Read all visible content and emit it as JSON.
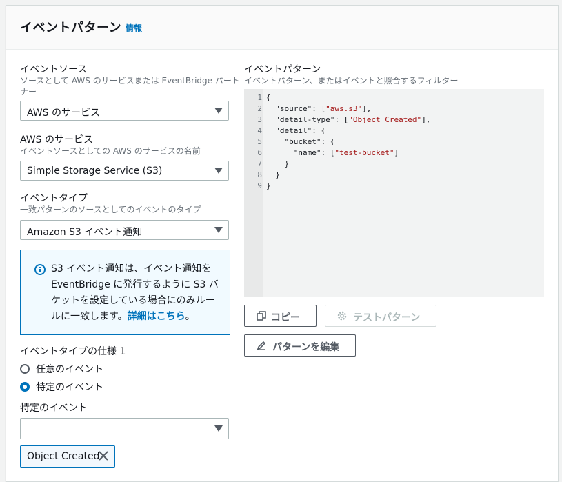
{
  "header": {
    "title": "イベントパターン",
    "info": "情報"
  },
  "event_source": {
    "label": "イベントソース",
    "desc1": "ソースとして AWS のサービスまたは EventBridge パート",
    "desc2": "ナー",
    "value": "AWS のサービス"
  },
  "aws_service": {
    "label": "AWS のサービス",
    "desc": "イベントソースとしての AWS のサービスの名前",
    "value": "Simple Storage Service (S3)"
  },
  "event_type": {
    "label": "イベントタイプ",
    "desc": "一致パターンのソースとしてのイベントのタイプ",
    "value": "Amazon S3 イベント通知"
  },
  "alert": {
    "line1": "S3 イベント通知は、イベント通知を",
    "line2": "EventBridge に発行するように S3 バ",
    "line3": "ケットを設定している場合にのみルー",
    "line4_pre": "ルに一致します。",
    "link": "詳細はこちら",
    "line4_post": "。"
  },
  "spec": {
    "label": "イベントタイプの仕様 1",
    "option_any": "任意のイベント",
    "option_specific": "特定のイベント",
    "selected": "option_specific"
  },
  "specific_events": {
    "label": "特定のイベント",
    "value": "",
    "token": "Object Created"
  },
  "pattern": {
    "label": "イベントパターン",
    "desc": "イベントパターン、またはイベントと照合するフィルター",
    "line_numbers": [
      "1",
      "2",
      "3",
      "4",
      "5",
      "6",
      "7",
      "8",
      "9"
    ],
    "lines": [
      "{",
      "  \"source\": [\"aws.s3\"],",
      "  \"detail-type\": [\"Object Created\"],",
      "  \"detail\": {",
      "    \"bucket\": {",
      "      \"name\": [\"test-bucket\"]",
      "    }",
      "  }",
      "}"
    ]
  },
  "buttons": {
    "copy": "コピー",
    "test": "テストパターン",
    "edit": "パターンを編集"
  },
  "colors": {
    "accent": "#0073bb",
    "alert_bg": "#f1faff",
    "string": "#a31515"
  }
}
